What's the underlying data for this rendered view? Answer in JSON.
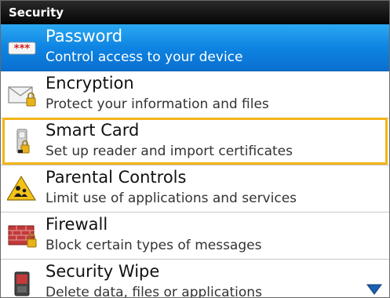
{
  "header": {
    "title": "Security"
  },
  "items": [
    {
      "name": "Password",
      "description": "Control access to your device",
      "icon": "password-icon",
      "selected": true
    },
    {
      "name": "Encryption",
      "description": "Protect your information and files",
      "icon": "encryption-icon"
    },
    {
      "name": "Smart Card",
      "description": "Set up reader and import certificates",
      "icon": "smart-card-icon",
      "highlighted": true
    },
    {
      "name": "Parental Controls",
      "description": "Limit use of applications and services",
      "icon": "parental-controls-icon"
    },
    {
      "name": "Firewall",
      "description": "Block certain types of messages",
      "icon": "firewall-icon"
    },
    {
      "name": "Security Wipe",
      "description": "Delete data, files or applications",
      "icon": "security-wipe-icon"
    }
  ],
  "scroll": {
    "icon": "scroll-down-arrow-icon"
  },
  "colors": {
    "selection": "#0e84e2",
    "highlight_border": "#f2b418",
    "title_bar": "#050505"
  }
}
